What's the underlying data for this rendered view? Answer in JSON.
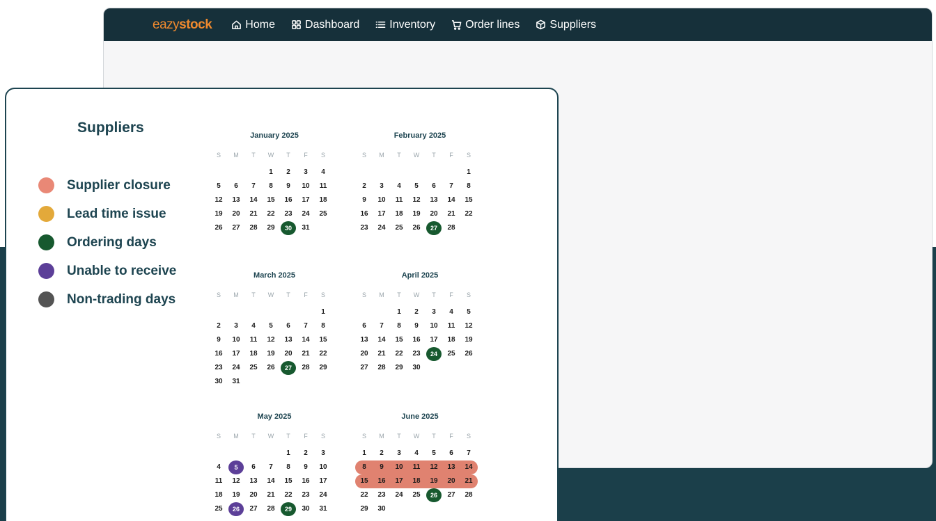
{
  "nav": {
    "logo_light": "eazy",
    "logo_bold": "stock",
    "items": [
      {
        "label": "Home",
        "icon": "home-icon"
      },
      {
        "label": "Dashboard",
        "icon": "dashboard-grid-icon"
      },
      {
        "label": "Inventory",
        "icon": "list-icon"
      },
      {
        "label": "Order lines",
        "icon": "cart-icon"
      },
      {
        "label": "Suppliers",
        "icon": "box-icon"
      }
    ]
  },
  "card": {
    "title": "Suppliers",
    "legend": [
      {
        "label": "Supplier closure",
        "color": "#e98876"
      },
      {
        "label": "Lead time issue",
        "color": "#e3a93a"
      },
      {
        "label": "Ordering days",
        "color": "#17592f"
      },
      {
        "label": "Unable to receive",
        "color": "#5c3f98"
      },
      {
        "label": "Non-trading days",
        "color": "#545454"
      }
    ]
  },
  "colors": {
    "navbar": "#16303a",
    "brand": "#f08a2e",
    "band": "#1b3f4a",
    "closure": "#e08270",
    "ordering": "#17592f",
    "unable": "#5c3f98"
  },
  "weekday_labels": [
    "S",
    "M",
    "T",
    "W",
    "T",
    "F",
    "S"
  ],
  "calendars": [
    {
      "title": "January 2025",
      "start": 3,
      "days": 31,
      "ordering": [
        30
      ],
      "unable": [],
      "closure_ranges": []
    },
    {
      "title": "February 2025",
      "start": 6,
      "days": 28,
      "ordering": [
        27
      ],
      "unable": [],
      "closure_ranges": []
    },
    {
      "title": "March 2025",
      "start": 6,
      "days": 31,
      "ordering": [
        27
      ],
      "unable": [],
      "closure_ranges": []
    },
    {
      "title": "April 2025",
      "start": 2,
      "days": 30,
      "ordering": [
        24
      ],
      "unable": [],
      "closure_ranges": []
    },
    {
      "title": "May 2025",
      "start": 4,
      "days": 31,
      "ordering": [
        29
      ],
      "unable": [
        5,
        26
      ],
      "closure_ranges": []
    },
    {
      "title": "June 2025",
      "start": 0,
      "days": 30,
      "ordering": [
        26
      ],
      "unable": [],
      "closure_ranges": [
        [
          8,
          14
        ],
        [
          15,
          21
        ]
      ]
    }
  ]
}
